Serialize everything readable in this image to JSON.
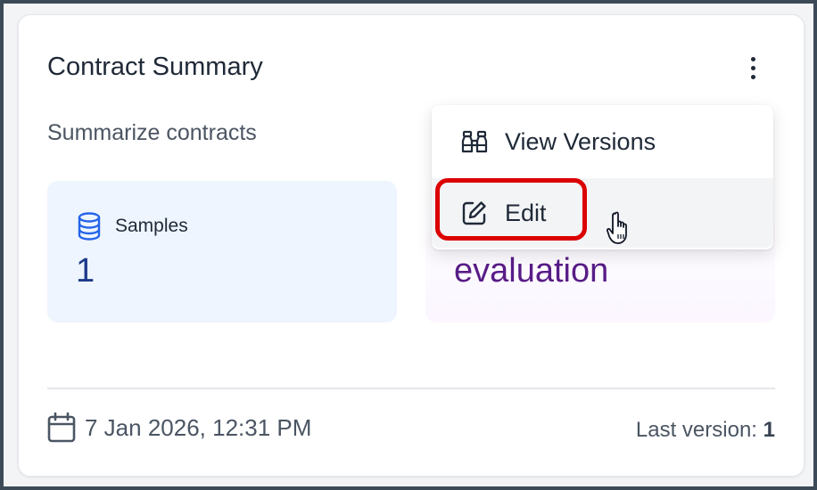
{
  "card": {
    "title": "Contract Summary",
    "description": "Summarize contracts",
    "more_icon": "kebab-vertical-icon"
  },
  "stats": {
    "samples": {
      "icon": "database-icon",
      "label": "Samples",
      "value": "1"
    },
    "evaluation": {
      "value": "evaluation"
    }
  },
  "footer": {
    "date_icon": "calendar-icon",
    "date": "7 Jan 2026, 12:31 PM",
    "version_label": "Last version:",
    "version_value": "1"
  },
  "menu": {
    "items": [
      {
        "icon": "binoculars-icon",
        "label": "View Versions"
      },
      {
        "icon": "edit-icon",
        "label": "Edit",
        "highlighted": true
      }
    ]
  },
  "colors": {
    "highlight": "#dc0000",
    "samples_bg": "#eef5fe",
    "samples_value": "#1e3a8a",
    "evaluation_text": "#581c87",
    "database_icon": "#2563eb"
  }
}
